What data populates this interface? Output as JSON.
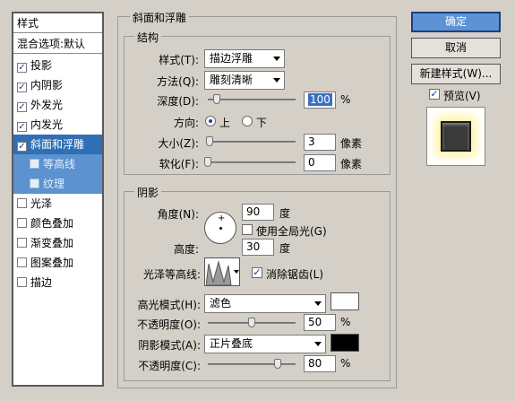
{
  "styles_panel": {
    "header": "样式",
    "blend": "混合选项:默认",
    "items": [
      {
        "label": "投影",
        "checked": "✓"
      },
      {
        "label": "内阴影",
        "checked": "✓"
      },
      {
        "label": "外发光",
        "checked": "✓"
      },
      {
        "label": "内发光",
        "checked": "✓"
      },
      {
        "label": "斜面和浮雕",
        "checked": "✓"
      },
      {
        "label": "等高线",
        "checked": ""
      },
      {
        "label": "纹理",
        "checked": ""
      },
      {
        "label": "光泽",
        "checked": ""
      },
      {
        "label": "颜色叠加",
        "checked": ""
      },
      {
        "label": "渐变叠加",
        "checked": ""
      },
      {
        "label": "图案叠加",
        "checked": ""
      },
      {
        "label": "描边",
        "checked": ""
      }
    ]
  },
  "bevel": {
    "title": "斜面和浮雕",
    "structure": {
      "title": "结构",
      "style_label": "样式(T):",
      "style_value": "描边浮雕",
      "technique_label": "方法(Q):",
      "technique_value": "雕刻清晰",
      "depth_label": "深度(D):",
      "depth_value": "100",
      "depth_unit": "%",
      "depth_level": 0.1,
      "direction_label": "方向:",
      "dir_up": "上",
      "dir_down": "下",
      "direction_selected": "上",
      "size_label": "大小(Z):",
      "size_value": "3",
      "size_unit": "像素",
      "soften_label": "软化(F):",
      "soften_value": "0",
      "soften_unit": "像素"
    },
    "shading": {
      "title": "阴影",
      "angle_label": "角度(N):",
      "angle_value": "90",
      "angle_unit": "度",
      "global_light_label": "使用全局光(G)",
      "altitude_label": "高度:",
      "altitude_value": "30",
      "altitude_unit": "度",
      "gloss_label": "光泽等高线:",
      "antialias_label": "消除锯齿(L)",
      "antialias_checked": "✓",
      "highlight_label": "高光模式(H):",
      "highlight_mode": "滤色",
      "highlight_color": "#ffffff",
      "highlight_opacity_label": "不透明度(O):",
      "highlight_opacity": "50",
      "opacity_unit": "%",
      "shadow_label": "阴影模式(A):",
      "shadow_mode": "正片叠底",
      "shadow_color": "#000000",
      "shadow_opacity_label": "不透明度(C):",
      "shadow_opacity": "80"
    }
  },
  "buttons": {
    "ok": "确定",
    "cancel": "取消",
    "new_style": "新建样式(W)...",
    "preview_label": "预览(V)",
    "preview_checked": "✓"
  },
  "colors": {
    "selection": "#2f6fb5",
    "default_button": "#5d93d6",
    "glow": "#fff3a0"
  }
}
